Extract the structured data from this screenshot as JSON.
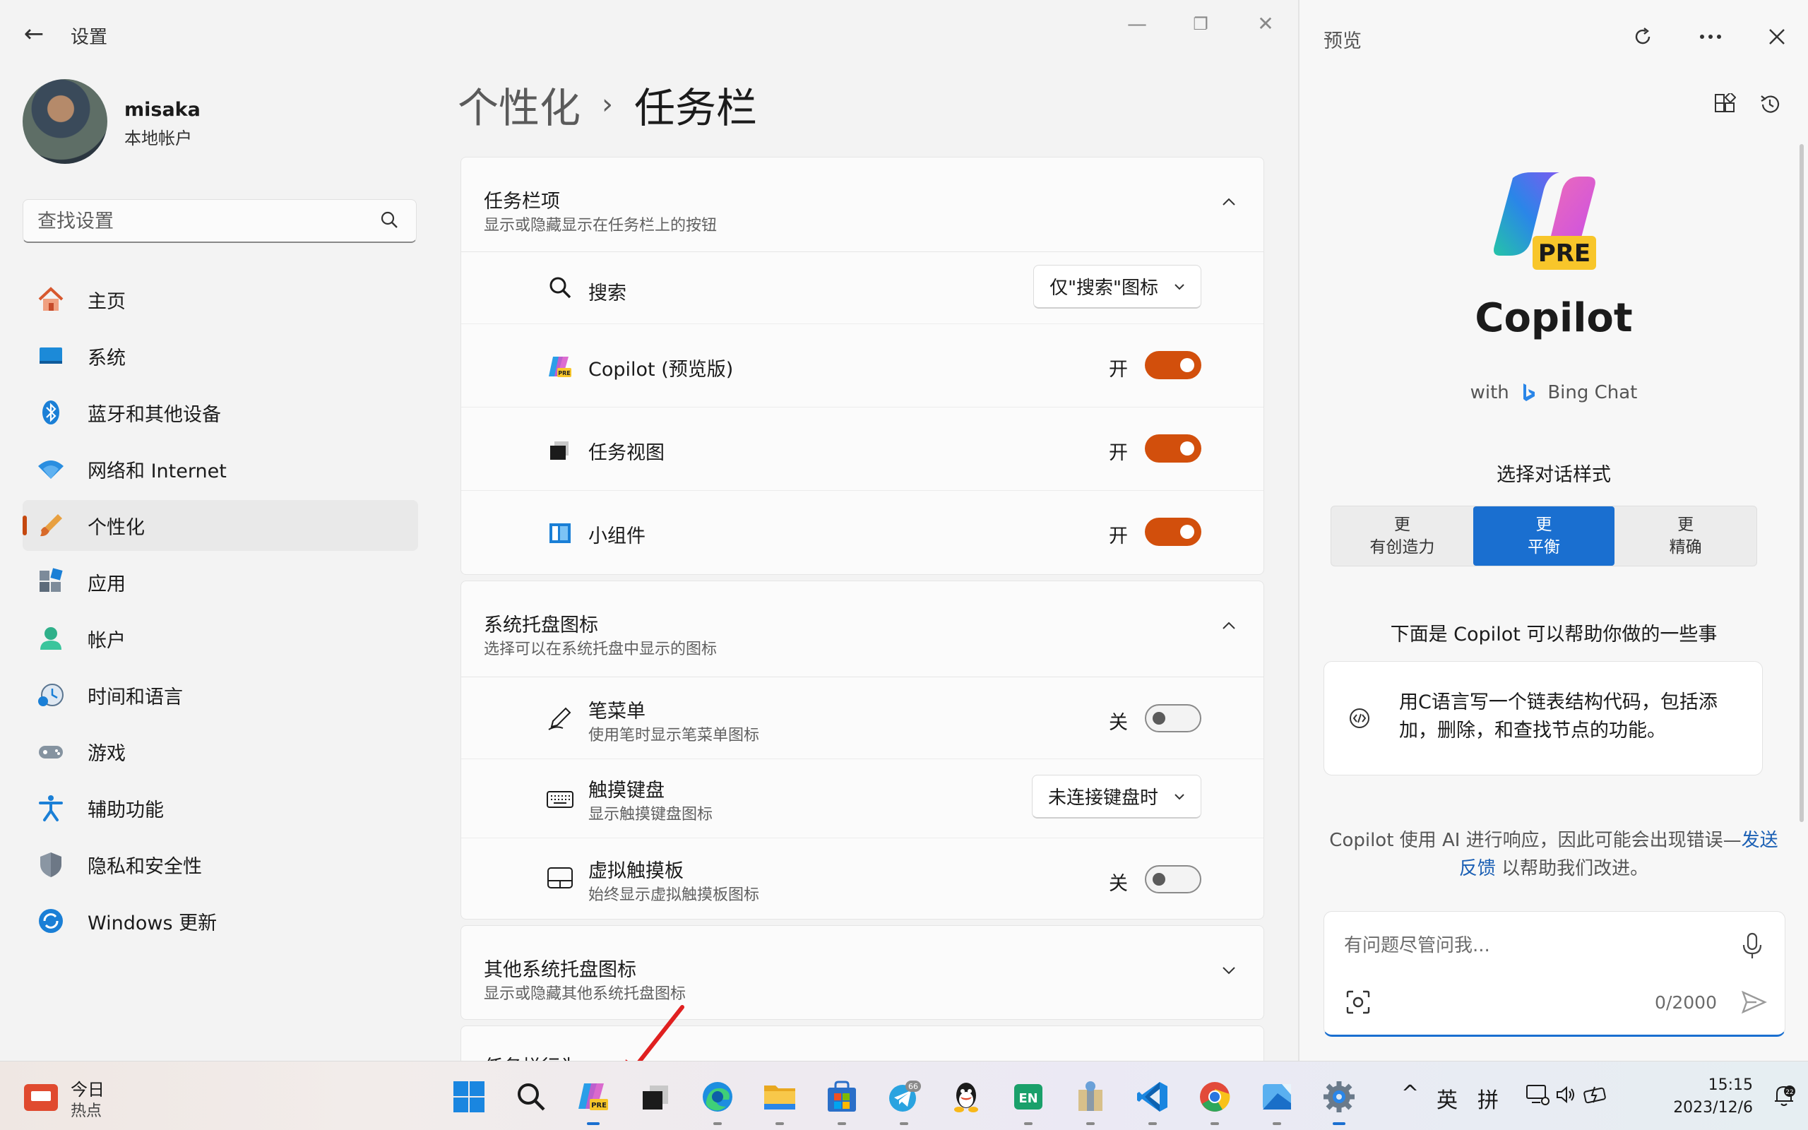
{
  "window": {
    "title": "设置",
    "back_glyph": "←",
    "minimize_glyph": "—",
    "maximize_glyph": "❐",
    "close_glyph": "✕"
  },
  "profile": {
    "name": "misaka",
    "account_type": "本地帐户"
  },
  "search": {
    "placeholder": "查找设置"
  },
  "sidebar": {
    "items": [
      {
        "label": "主页",
        "icon": "home-icon"
      },
      {
        "label": "系统",
        "icon": "system-icon"
      },
      {
        "label": "蓝牙和其他设备",
        "icon": "bluetooth-icon"
      },
      {
        "label": "网络和 Internet",
        "icon": "wifi-icon"
      },
      {
        "label": "个性化",
        "icon": "brush-icon",
        "active": true
      },
      {
        "label": "应用",
        "icon": "apps-icon"
      },
      {
        "label": "帐户",
        "icon": "account-icon"
      },
      {
        "label": "时间和语言",
        "icon": "time-language-icon"
      },
      {
        "label": "游戏",
        "icon": "gaming-icon"
      },
      {
        "label": "辅助功能",
        "icon": "accessibility-icon"
      },
      {
        "label": "隐私和安全性",
        "icon": "shield-icon"
      },
      {
        "label": "Windows 更新",
        "icon": "update-icon"
      }
    ]
  },
  "breadcrumb": {
    "parent": "个性化",
    "separator": "›",
    "current": "任务栏"
  },
  "sections": {
    "taskbar_items": {
      "title": "任务栏项",
      "subtitle": "显示或隐藏显示在任务栏上的按钮",
      "rows": {
        "search": {
          "label": "搜索",
          "dropdown": "仅\"搜索\"图标"
        },
        "copilot": {
          "label": "Copilot (预览版)",
          "state": "开"
        },
        "task_view": {
          "label": "任务视图",
          "state": "开"
        },
        "widgets": {
          "label": "小组件",
          "state": "开"
        }
      }
    },
    "tray_icons": {
      "title": "系统托盘图标",
      "subtitle": "选择可以在系统托盘中显示的图标",
      "rows": {
        "pen": {
          "label": "笔菜单",
          "sub": "使用笔时显示笔菜单图标",
          "state": "关"
        },
        "touch_keyboard": {
          "label": "触摸键盘",
          "sub": "显示触摸键盘图标",
          "dropdown": "未连接键盘时"
        },
        "touchpad": {
          "label": "虚拟触摸板",
          "sub": "始终显示虚拟触摸板图标",
          "state": "关"
        }
      }
    },
    "other_tray": {
      "title": "其他系统托盘图标",
      "subtitle": "显示或隐藏其他系统托盘图标"
    },
    "behaviors": {
      "title": "任务栏行为"
    }
  },
  "copilot": {
    "pane_title": "预览",
    "logo_badge": "PRE",
    "name": "Copilot",
    "with_prefix": "with",
    "with_product": "Bing Chat",
    "style_title": "选择对话样式",
    "styles": [
      {
        "line1": "更",
        "line2": "有创造力"
      },
      {
        "line1": "更",
        "line2": "平衡",
        "selected": true
      },
      {
        "line1": "更",
        "line2": "精确"
      }
    ],
    "help_title": "下面是 Copilot 可以帮助你做的一些事",
    "prompt": "用C语言写一个链表结构代码，包括添加，删除，和查找节点的功能。",
    "disclaimer_before": "Copilot 使用 AI 进行响应，因此可能会出现错误—",
    "disclaimer_link": "发送反馈",
    "disclaimer_after": " 以帮助我们改进。",
    "input_placeholder": "有问题尽管问我...",
    "char_count": "0/2000"
  },
  "taskbar": {
    "news_title": "今日",
    "news_sub": "热点",
    "telegram_badge": "66",
    "app_icons": [
      "windows-start-icon",
      "search-icon",
      "copilot-icon",
      "task-view-icon",
      "edge-icon",
      "file-explorer-icon",
      "store-icon",
      "telegram-icon",
      "qq-icon",
      "en-dict-icon",
      "archive-icon",
      "vscode-icon",
      "chrome-icon",
      "photos-icon",
      "settings-icon"
    ],
    "tray_chevron": "^",
    "ime_lang": "英",
    "ime_mode": "拼",
    "time": "15:15",
    "date": "2023/12/6",
    "notification_count": "22"
  },
  "colors": {
    "accent": "#d24f0c",
    "copilot_blue": "#1a6fd0"
  }
}
